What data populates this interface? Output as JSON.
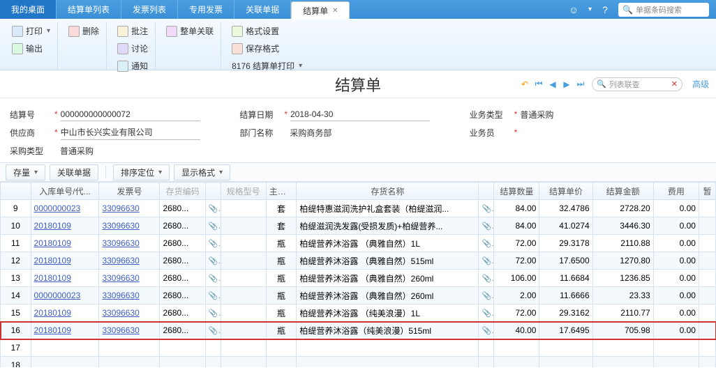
{
  "tabs": {
    "items": [
      "我的桌面",
      "结算单列表",
      "发票列表",
      "专用发票",
      "关联单据",
      "结算单"
    ],
    "active_index": 5,
    "search_placeholder": "单据条码搜索"
  },
  "ribbon": {
    "g1": {
      "print": "打印",
      "delete": "删除",
      "export": "输出"
    },
    "g2": {
      "note": "批注",
      "discuss": "讨论",
      "notify": "通知"
    },
    "g3": {
      "relate": "整单关联"
    },
    "g4": {
      "fmt": "格式设置",
      "savefmt": "保存格式",
      "printfmt": "8176 结算单打印"
    }
  },
  "title": "结算单",
  "nav_search_placeholder": "列表联查",
  "adv_label": "高级",
  "form": {
    "settle_no": {
      "label": "结算号",
      "value": "000000000000072"
    },
    "supplier": {
      "label": "供应商",
      "value": "中山市长兴实业有限公司"
    },
    "purchase_type": {
      "label": "采购类型",
      "value": "普通采购"
    },
    "settle_date": {
      "label": "结算日期",
      "value": "2018-04-30"
    },
    "dept": {
      "label": "部门名称",
      "value": "采购商务部"
    },
    "biz_type": {
      "label": "业务类型",
      "value": "普通采购"
    },
    "biz_person": {
      "label": "业务员",
      "value": ""
    }
  },
  "sub_tb": {
    "stock": "存量",
    "rel": "关联单据",
    "sort": "排序定位",
    "disp": "显示格式"
  },
  "columns": {
    "warehouse_no": "入库单号/代...",
    "invoice_no": "发票号",
    "stock_code": "存货编码",
    "spec": "规格型号",
    "uom": "主计量",
    "stock_name": "存货名称",
    "qty": "结算数量",
    "price": "结算单价",
    "amount": "结算金额",
    "fee": "费用",
    "stub": "暂"
  },
  "rows": [
    {
      "idx": "9",
      "wn": "0000000023",
      "inv": "33096630",
      "code": "2680...",
      "uom": "套",
      "name": "柏缇特惠滋润洗护礼盒套装（柏缇滋润...",
      "qty": "84.00",
      "price": "32.4786",
      "amt": "2728.20",
      "fee": "0.00"
    },
    {
      "idx": "10",
      "wn": "20180109",
      "inv": "33096630",
      "code": "2680...",
      "uom": "套",
      "name": "柏缇滋润洗发露(受损发质)+柏缇营养...",
      "qty": "84.00",
      "price": "41.0274",
      "amt": "3446.30",
      "fee": "0.00"
    },
    {
      "idx": "11",
      "wn": "20180109",
      "inv": "33096630",
      "code": "2680...",
      "uom": "瓶",
      "name": "柏缇营养沐浴露 （典雅自然）1L",
      "qty": "72.00",
      "price": "29.3178",
      "amt": "2110.88",
      "fee": "0.00"
    },
    {
      "idx": "12",
      "wn": "20180109",
      "inv": "33096630",
      "code": "2680...",
      "uom": "瓶",
      "name": "柏缇营养沐浴露 （典雅自然）515ml",
      "qty": "72.00",
      "price": "17.6500",
      "amt": "1270.80",
      "fee": "0.00"
    },
    {
      "idx": "13",
      "wn": "20180109",
      "inv": "33096630",
      "code": "2680...",
      "uom": "瓶",
      "name": "柏缇营养沐浴露 （典雅自然）260ml",
      "qty": "106.00",
      "price": "11.6684",
      "amt": "1236.85",
      "fee": "0.00"
    },
    {
      "idx": "14",
      "wn": "0000000023",
      "inv": "33096630",
      "code": "2680...",
      "uom": "瓶",
      "name": "柏缇营养沐浴露 （典雅自然）260ml",
      "qty": "2.00",
      "price": "11.6666",
      "amt": "23.33",
      "fee": "0.00"
    },
    {
      "idx": "15",
      "wn": "20180109",
      "inv": "33096630",
      "code": "2680...",
      "uom": "瓶",
      "name": "柏缇营养沐浴露 （纯美浪漫）1L",
      "qty": "72.00",
      "price": "29.3162",
      "amt": "2110.77",
      "fee": "0.00"
    },
    {
      "idx": "16",
      "wn": "20180109",
      "inv": "33096630",
      "code": "2680...",
      "uom": "瓶",
      "name": "柏缇营养沐浴露（纯美浪漫）515ml",
      "qty": "40.00",
      "price": "17.6495",
      "amt": "705.98",
      "fee": "0.00",
      "hl": true
    },
    {
      "idx": "17",
      "wn": "",
      "inv": "",
      "code": "",
      "uom": "",
      "name": "",
      "qty": "",
      "price": "",
      "amt": "",
      "fee": "",
      "empty": true
    },
    {
      "idx": "18",
      "wn": "",
      "inv": "",
      "code": "",
      "uom": "",
      "name": "",
      "qty": "",
      "price": "",
      "amt": "",
      "fee": "",
      "empty": true
    }
  ]
}
